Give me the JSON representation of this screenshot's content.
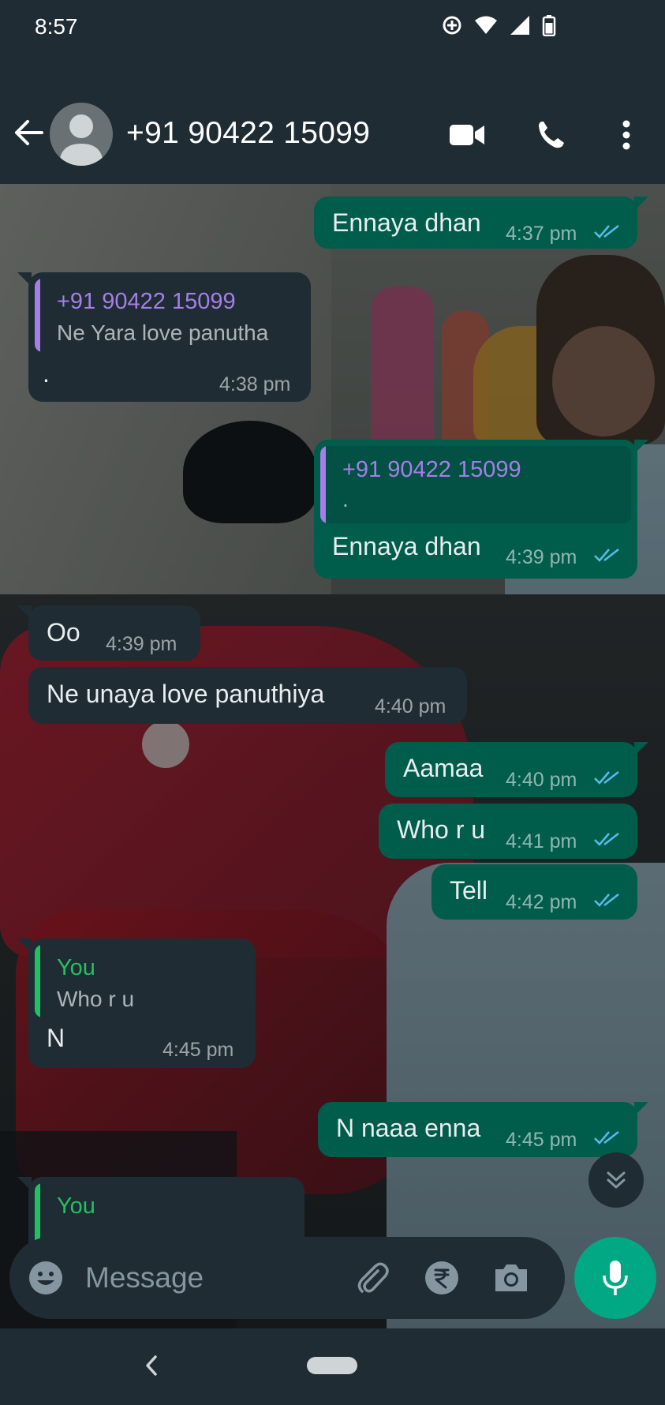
{
  "status_bar": {
    "time": "8:57"
  },
  "header": {
    "contact_name": "+91 90422 15099",
    "icons": [
      "back-arrow-icon",
      "avatar-icon",
      "video-call-icon",
      "voice-call-icon",
      "more-options-icon"
    ]
  },
  "messages": [
    {
      "direction": "out",
      "text": "Ennaya dhan",
      "time": "4:37 pm",
      "read": true
    },
    {
      "direction": "in",
      "quote": {
        "author": "+91 90422 15099",
        "text": "Ne Yara love panutha"
      },
      "text": ".",
      "time": "4:38 pm"
    },
    {
      "direction": "out",
      "quote": {
        "author": "+91 90422 15099",
        "text": "."
      },
      "text": "Ennaya dhan",
      "time": "4:39 pm",
      "read": true
    },
    {
      "direction": "in",
      "text": "Oo",
      "time": "4:39 pm"
    },
    {
      "direction": "in",
      "text": "Ne unaya love panuthiya",
      "time": "4:40 pm"
    },
    {
      "direction": "out",
      "text": "Aamaa",
      "time": "4:40 pm",
      "read": true
    },
    {
      "direction": "out",
      "text": "Who r u",
      "time": "4:41 pm",
      "read": true
    },
    {
      "direction": "out",
      "text": "Tell",
      "time": "4:42 pm",
      "read": true
    },
    {
      "direction": "in",
      "quote": {
        "author": "You",
        "text": "Who r u"
      },
      "text": "N",
      "time": "4:45 pm"
    },
    {
      "direction": "out",
      "text": "N naaa enna",
      "time": "4:45 pm",
      "read": true
    },
    {
      "direction": "in",
      "quote": {
        "author": "You",
        "text": ""
      },
      "text": "",
      "time": ""
    }
  ],
  "composer": {
    "placeholder": "Message",
    "icons": [
      "emoji-icon",
      "attach-icon",
      "rupee-payment-icon",
      "camera-icon",
      "mic-icon"
    ]
  },
  "colors": {
    "outgoing_bubble": "#005c4b",
    "incoming_bubble": "#1f2c34",
    "header": "#1f2c34",
    "accent": "#00a884",
    "quote_other": "#a57ee6",
    "quote_you": "#21c063",
    "read_ticks": "#53bdeb"
  }
}
